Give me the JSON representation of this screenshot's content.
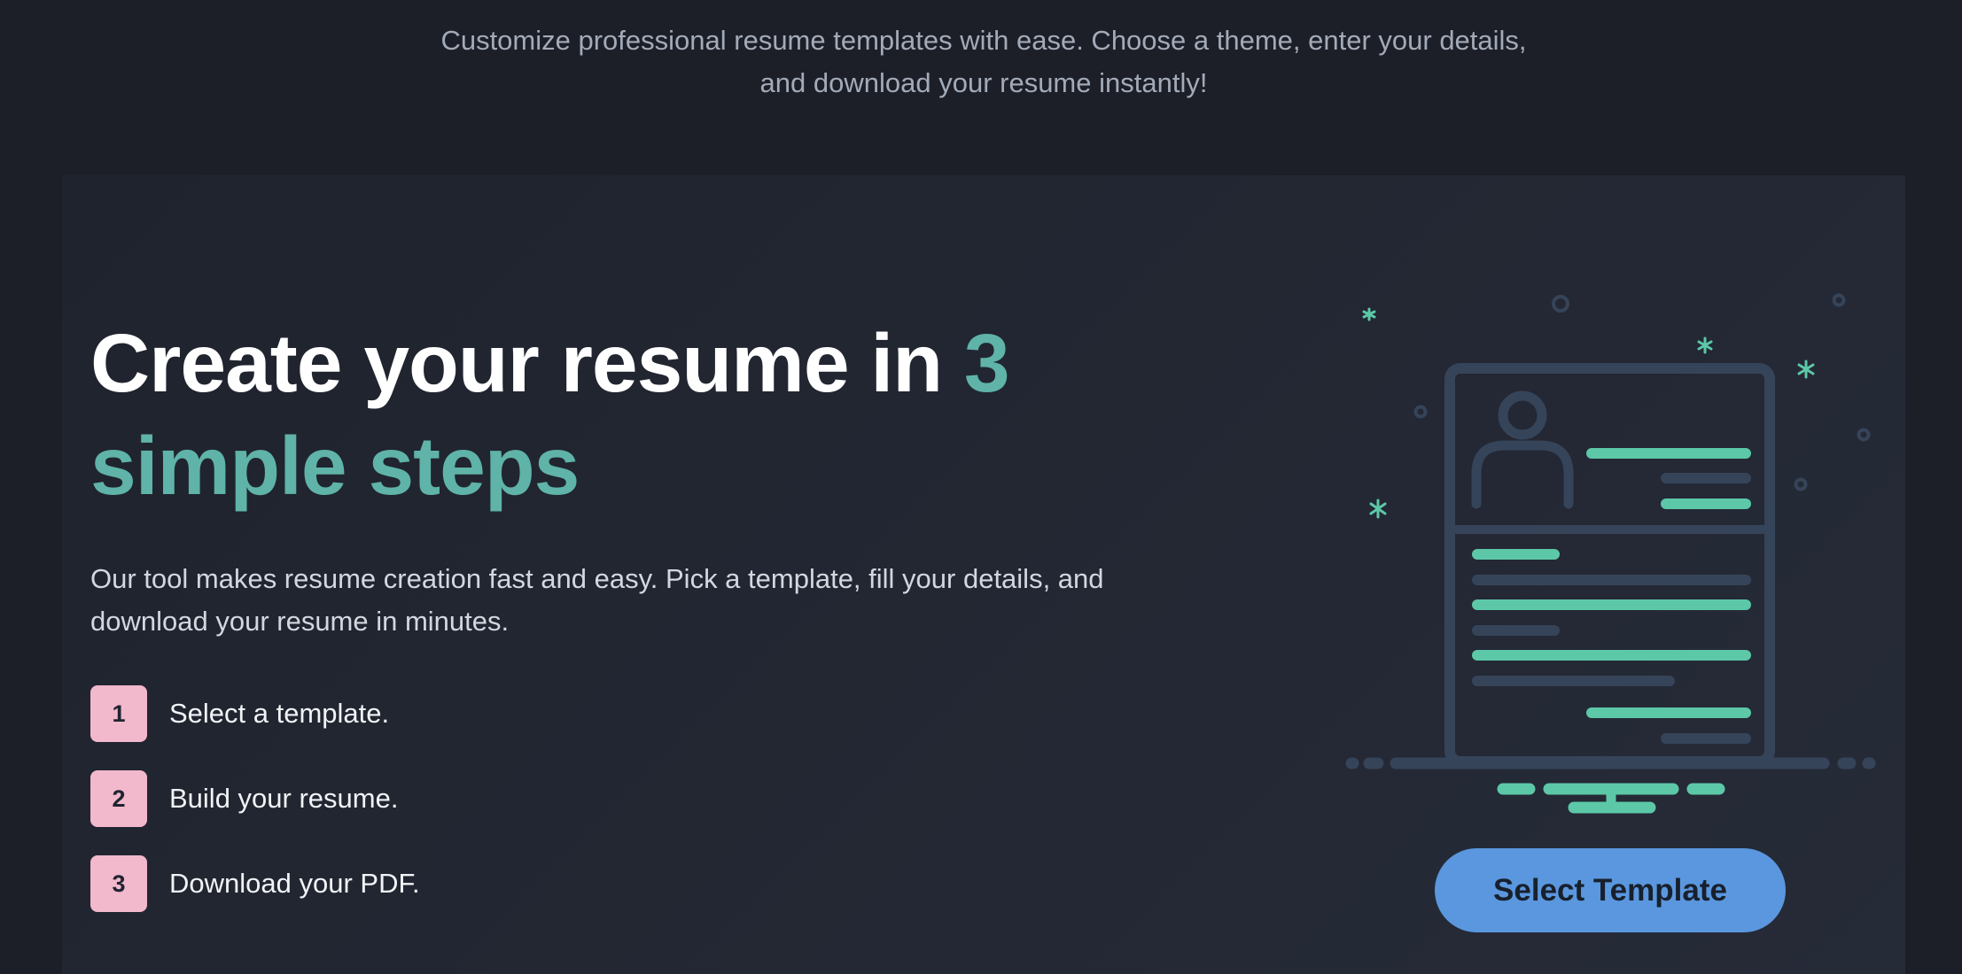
{
  "intro": {
    "line1": "Customize professional resume templates with ease. Choose a theme, enter your details,",
    "line2": "and download your resume instantly!"
  },
  "hero": {
    "title_part1": "Create your resume in ",
    "title_accent": "3",
    "title_part2": "simple steps",
    "description": "Our tool makes resume creation fast and easy. Pick a template, fill your details, and download your resume in minutes.",
    "steps": [
      {
        "number": "1",
        "label": "Select a template."
      },
      {
        "number": "2",
        "label": "Build your resume."
      },
      {
        "number": "3",
        "label": "Download your PDF."
      }
    ],
    "button_label": "Select Template",
    "illustration_icon": "resume-document-icon"
  },
  "colors": {
    "page_background": "#1c1f28",
    "card_background": "#232834",
    "accent": "#5fb3a8",
    "step_badge": "#f2b8cb",
    "button": "#5a97de",
    "illustration_line": "#364459",
    "illustration_accent": "#5cc8a8"
  }
}
